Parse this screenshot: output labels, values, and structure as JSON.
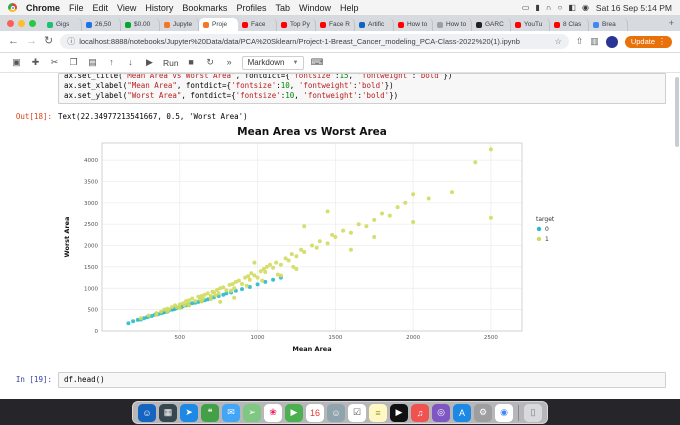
{
  "menu_bar": {
    "app_name": "Chrome",
    "items": [
      "File",
      "Edit",
      "View",
      "History",
      "Bookmarks",
      "Profiles",
      "Tab",
      "Window",
      "Help"
    ],
    "status_icons": [
      {
        "name": "screen-mirroring-icon",
        "glyph": "▭"
      },
      {
        "name": "battery-icon",
        "glyph": "▮"
      },
      {
        "name": "wifi-icon",
        "glyph": "∩"
      },
      {
        "name": "search-icon",
        "glyph": "○"
      },
      {
        "name": "control-center-icon",
        "glyph": "◧"
      },
      {
        "name": "siri-icon",
        "glyph": "◉"
      }
    ],
    "clock": "Sat 16 Sep 5:14 PM"
  },
  "browser": {
    "nav": {
      "back": "←",
      "forward": "→",
      "reload": "↻"
    },
    "tabs": [
      {
        "label": "Gigs",
        "color": "#1dbf73",
        "active": false
      },
      {
        "label": "26,50",
        "color": "#1a73e8",
        "active": false
      },
      {
        "label": "$0.00",
        "color": "#00a82d",
        "active": false
      },
      {
        "label": "Jupyte",
        "color": "#f37726",
        "active": false
      },
      {
        "label": "Proje",
        "color": "#f37726",
        "active": true
      },
      {
        "label": "Face",
        "color": "#ff0000",
        "active": false
      },
      {
        "label": "Top Py",
        "color": "#ff0000",
        "active": false
      },
      {
        "label": "Face R",
        "color": "#ff0000",
        "active": false
      },
      {
        "label": "Artific",
        "color": "#0a66c2",
        "active": false
      },
      {
        "label": "How to",
        "color": "#ff0000",
        "active": false
      },
      {
        "label": "How to",
        "color": "#9aa0a6",
        "active": false
      },
      {
        "label": "GARC",
        "color": "#202124",
        "active": false
      },
      {
        "label": "YouTu",
        "color": "#ff0000",
        "active": false
      },
      {
        "label": "8 Clas",
        "color": "#ff0000",
        "active": false
      },
      {
        "label": "Brea",
        "color": "#4285f4",
        "active": false
      }
    ],
    "new_tab_glyph": "+",
    "info_icon": "ⓘ",
    "url": "localhost:8888/notebooks/Jupyter%20Data/data/PCA%20Sklearn/Project-1-Breast_Cancer_modeling_PCA-Class-2022%20(1).ipynb",
    "star_icon": "☆",
    "share_icon": "⇧",
    "sidebar_icon": "▥",
    "update_label": "Update",
    "kebab_icon": "⋮"
  },
  "jupyter": {
    "toolbar": {
      "items": [
        {
          "name": "save",
          "glyph": "▣"
        },
        {
          "name": "add-cell",
          "glyph": "✚"
        },
        {
          "name": "cut-cells",
          "glyph": "✂"
        },
        {
          "name": "copy-cells",
          "glyph": "❐"
        },
        {
          "name": "paste-cells",
          "glyph": "▤"
        },
        {
          "name": "move-cell-up",
          "glyph": "↑"
        },
        {
          "name": "move-cell-down",
          "glyph": "↓"
        },
        {
          "name": "run",
          "glyph": "▶",
          "label": "Run"
        },
        {
          "name": "interrupt-kernel",
          "glyph": "■"
        },
        {
          "name": "restart-kernel",
          "glyph": "↻"
        },
        {
          "name": "restart-run-all",
          "glyph": "»"
        }
      ],
      "mode": "Markdown",
      "keyboard_glyph": "⌨"
    },
    "cells": {
      "code_lines": [
        "ax.set_title(\"Mean Area vs Worst Area\", fontdict={'fontsize':15, 'fontweight':'bold'})",
        "ax.set_xlabel(\"Mean Area\", fontdict={'fontsize':10, 'fontweight':'bold'})",
        "ax.set_ylabel(\"Worst Area\", fontdict={'fontsize':10, 'fontweight':'bold'})"
      ],
      "out_prompt": "Out[18]:",
      "out_text": "Text(22.34977213541667, 0.5, 'Worst Area')",
      "in_prompt": "In [19]:",
      "in_code": "df.head()"
    }
  },
  "chart_data": {
    "type": "scatter",
    "title": "Mean Area vs Worst Area",
    "xlabel": "Mean Area",
    "ylabel": "Worst Area",
    "xlim": [
      0,
      2700
    ],
    "ylim": [
      0,
      4400
    ],
    "xticks": [
      500,
      1000,
      1500,
      2000,
      2500
    ],
    "yticks": [
      0,
      500,
      1000,
      1500,
      2000,
      2500,
      3000,
      3500,
      4000
    ],
    "grid": true,
    "legend_title": "target",
    "legend_position": "right",
    "series": [
      {
        "name": "0",
        "color": "#2ab9cc",
        "points": [
          [
            170,
            180
          ],
          [
            200,
            230
          ],
          [
            230,
            260
          ],
          [
            250,
            270
          ],
          [
            270,
            300
          ],
          [
            290,
            320
          ],
          [
            300,
            340
          ],
          [
            320,
            350
          ],
          [
            340,
            380
          ],
          [
            350,
            400
          ],
          [
            360,
            390
          ],
          [
            380,
            420
          ],
          [
            390,
            430
          ],
          [
            400,
            440
          ],
          [
            410,
            460
          ],
          [
            420,
            450
          ],
          [
            430,
            480
          ],
          [
            450,
            500
          ],
          [
            460,
            510
          ],
          [
            470,
            520
          ],
          [
            480,
            540
          ],
          [
            500,
            550
          ],
          [
            510,
            560
          ],
          [
            520,
            580
          ],
          [
            540,
            600
          ],
          [
            550,
            610
          ],
          [
            560,
            620
          ],
          [
            580,
            650
          ],
          [
            600,
            660
          ],
          [
            620,
            680
          ],
          [
            640,
            700
          ],
          [
            660,
            720
          ],
          [
            680,
            740
          ],
          [
            700,
            760
          ],
          [
            720,
            790
          ],
          [
            750,
            820
          ],
          [
            780,
            850
          ],
          [
            800,
            880
          ],
          [
            830,
            900
          ],
          [
            860,
            940
          ],
          [
            900,
            980
          ],
          [
            950,
            1030
          ],
          [
            1000,
            1090
          ],
          [
            1050,
            1150
          ],
          [
            1100,
            1200
          ],
          [
            1150,
            1250
          ]
        ]
      },
      {
        "name": "1",
        "color": "#d2da5e",
        "points": [
          [
            250,
            300
          ],
          [
            300,
            360
          ],
          [
            350,
            420
          ],
          [
            380,
            450
          ],
          [
            400,
            500
          ],
          [
            420,
            520
          ],
          [
            450,
            560
          ],
          [
            470,
            600
          ],
          [
            480,
            560
          ],
          [
            500,
            620
          ],
          [
            520,
            650
          ],
          [
            540,
            700
          ],
          [
            550,
            640
          ],
          [
            560,
            720
          ],
          [
            580,
            760
          ],
          [
            600,
            700
          ],
          [
            620,
            800
          ],
          [
            640,
            820
          ],
          [
            650,
            760
          ],
          [
            660,
            850
          ],
          [
            680,
            880
          ],
          [
            700,
            820
          ],
          [
            710,
            920
          ],
          [
            720,
            900
          ],
          [
            740,
            960
          ],
          [
            750,
            880
          ],
          [
            760,
            1000
          ],
          [
            780,
            1020
          ],
          [
            800,
            950
          ],
          [
            820,
            1080
          ],
          [
            840,
            1100
          ],
          [
            850,
            1000
          ],
          [
            860,
            1150
          ],
          [
            880,
            1180
          ],
          [
            900,
            1100
          ],
          [
            920,
            1250
          ],
          [
            940,
            1280
          ],
          [
            950,
            1200
          ],
          [
            960,
            1350
          ],
          [
            980,
            1300
          ],
          [
            1000,
            1250
          ],
          [
            1020,
            1400
          ],
          [
            1040,
            1450
          ],
          [
            1050,
            1380
          ],
          [
            1060,
            1500
          ],
          [
            1080,
            1550
          ],
          [
            1100,
            1480
          ],
          [
            1120,
            1600
          ],
          [
            1150,
            1550
          ],
          [
            1180,
            1700
          ],
          [
            1200,
            1650
          ],
          [
            1220,
            1800
          ],
          [
            1250,
            1750
          ],
          [
            1280,
            1900
          ],
          [
            1300,
            1850
          ],
          [
            1350,
            2000
          ],
          [
            1380,
            1950
          ],
          [
            1400,
            2100
          ],
          [
            1450,
            2050
          ],
          [
            1480,
            2250
          ],
          [
            1500,
            2200
          ],
          [
            1550,
            2350
          ],
          [
            1600,
            2300
          ],
          [
            1650,
            2500
          ],
          [
            1700,
            2450
          ],
          [
            1750,
            2600
          ],
          [
            1800,
            2750
          ],
          [
            1850,
            2700
          ],
          [
            1900,
            2900
          ],
          [
            1950,
            3000
          ],
          [
            2000,
            3200
          ],
          [
            2100,
            3100
          ],
          [
            2250,
            3250
          ],
          [
            2400,
            3950
          ],
          [
            2500,
            4250
          ],
          [
            2500,
            2650
          ],
          [
            1300,
            2450
          ],
          [
            1450,
            2800
          ],
          [
            1150,
            1300
          ],
          [
            980,
            1600
          ],
          [
            760,
            680
          ],
          [
            850,
            780
          ],
          [
            1250,
            1450
          ],
          [
            1600,
            1900
          ],
          [
            1750,
            2200
          ],
          [
            2000,
            2550
          ],
          [
            430,
            500
          ],
          [
            530,
            600
          ],
          [
            630,
            740
          ],
          [
            730,
            830
          ],
          [
            830,
            940
          ],
          [
            930,
            1060
          ],
          [
            1030,
            1180
          ],
          [
            1130,
            1320
          ],
          [
            1230,
            1500
          ],
          [
            350,
            380
          ],
          [
            420,
            460
          ],
          [
            500,
            540
          ],
          [
            560,
            600
          ],
          [
            640,
            690
          ],
          [
            700,
            750
          ]
        ]
      }
    ]
  },
  "dock": {
    "items": [
      {
        "name": "finder",
        "color": "#1565c0",
        "glyph": "☺",
        "fg": "#ffffff"
      },
      {
        "name": "launchpad",
        "color": "#37474f",
        "glyph": "▦",
        "fg": "#ffffff"
      },
      {
        "name": "safari",
        "color": "#1e88e5",
        "glyph": "➤",
        "fg": "#ffffff"
      },
      {
        "name": "messages",
        "color": "#43a047",
        "glyph": "❝",
        "fg": "#ffffff"
      },
      {
        "name": "mail",
        "color": "#42a5f5",
        "glyph": "✉",
        "fg": "#ffffff"
      },
      {
        "name": "maps",
        "color": "#81c784",
        "glyph": "➢",
        "fg": "#ffffff"
      },
      {
        "name": "photos",
        "color": "#ffffff",
        "glyph": "❀",
        "fg": "#e91e63"
      },
      {
        "name": "facetime",
        "color": "#4caf50",
        "glyph": "▶",
        "fg": "#ffffff"
      },
      {
        "name": "calendar",
        "color": "#ffffff",
        "glyph": "16",
        "fg": "#e53935"
      },
      {
        "name": "contacts",
        "color": "#90a4ae",
        "glyph": "☺",
        "fg": "#ffffff"
      },
      {
        "name": "reminders",
        "color": "#ffffff",
        "glyph": "☑",
        "fg": "#555555"
      },
      {
        "name": "notes",
        "color": "#fff8c4",
        "glyph": "≡",
        "fg": "#9e9d24"
      },
      {
        "name": "tv",
        "color": "#111111",
        "glyph": "▶",
        "fg": "#ffffff"
      },
      {
        "name": "music",
        "color": "#ef5350",
        "glyph": "♫",
        "fg": "#ffffff"
      },
      {
        "name": "podcasts",
        "color": "#7e57c2",
        "glyph": "◎",
        "fg": "#ffffff"
      },
      {
        "name": "app-store",
        "color": "#1e88e5",
        "glyph": "A",
        "fg": "#ffffff"
      },
      {
        "name": "system-preferences",
        "color": "#9e9e9e",
        "glyph": "⚙",
        "fg": "#ffffff"
      },
      {
        "name": "chrome",
        "color": "#ffffff",
        "glyph": "◉",
        "fg": "#4285f4"
      }
    ],
    "trash": {
      "name": "trash",
      "color": "#d7d9dc",
      "glyph": "▯",
      "fg": "#777777"
    }
  }
}
